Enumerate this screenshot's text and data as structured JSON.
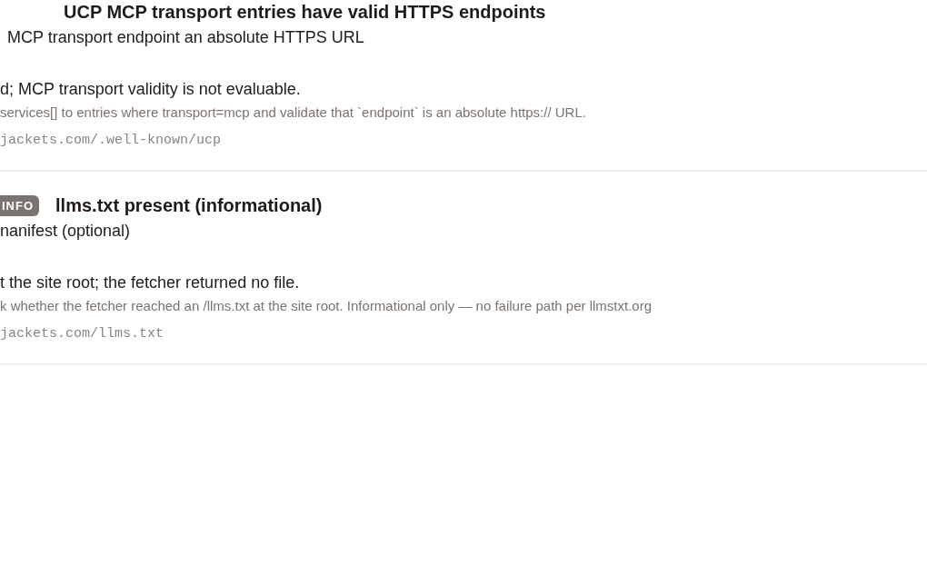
{
  "checks": [
    {
      "title": "UCP MCP transport entries have valid HTTPS endpoints",
      "subtitle": "MCP transport endpoint an absolute HTTPS URL",
      "finding": "d; MCP transport validity is not evaluable.",
      "detail": "services[] to entries where transport=mcp and validate that `endpoint` is an absolute https:// URL.",
      "url": "jackets.com/.well-known/ucp"
    },
    {
      "badge": "INFO",
      "title": "llms.txt present (informational)",
      "subtitle": "nanifest (optional)",
      "finding": "t the site root; the fetcher returned no file.",
      "detail": "k whether the fetcher reached an /llms.txt at the site root. Informational only — no failure path per llmstxt.org",
      "url": "jackets.com/llms.txt"
    }
  ]
}
